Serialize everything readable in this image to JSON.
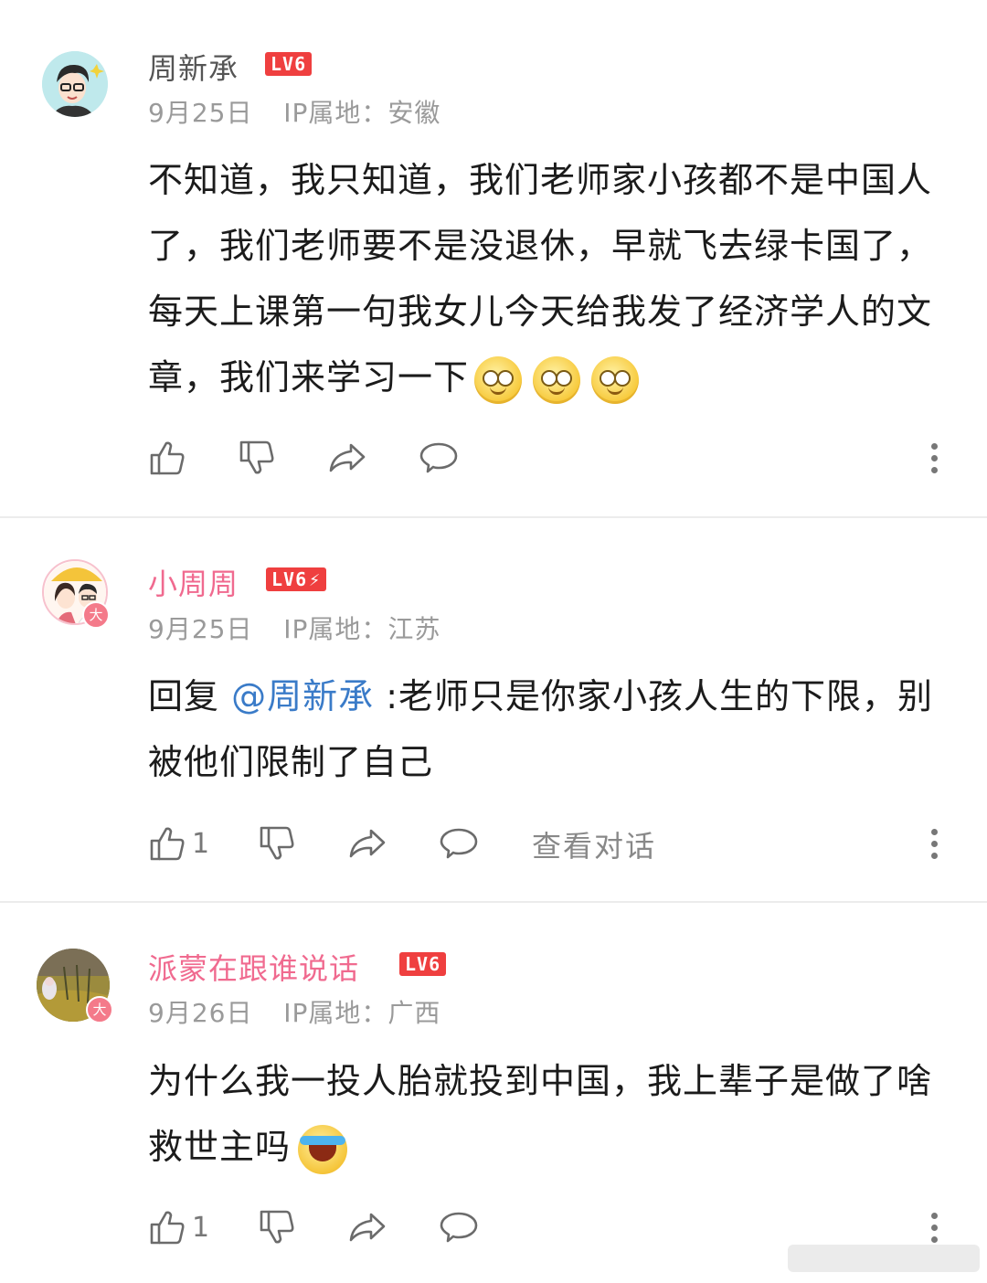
{
  "comments": [
    {
      "username": "周新承",
      "level": "LV6",
      "date": "9月25日",
      "ip_label": "IP属地：",
      "ip_location": "安徽",
      "content": "不知道，我只知道，我们老师家小孩都不是中国人了，我们老师要不是没退休，早就飞去绿卡国了，每天上课第一句我女儿今天给我发了经济学人的文章，我们来学习一下",
      "emojis": [
        "dizzy-face",
        "dizzy-face",
        "dizzy-face"
      ],
      "like_count": ""
    },
    {
      "username": "小周周",
      "level": "LV6",
      "verified_badge": "大",
      "date": "9月25日",
      "ip_label": "IP属地：",
      "ip_location": "江苏",
      "reply_prefix": "回复",
      "mention": "@周新承",
      "content": ":老师只是你家小孩人生的下限，别被他们限制了自己",
      "like_count": "1",
      "view_conversation": "查看对话"
    },
    {
      "username": "派蒙在跟谁说话",
      "level": "LV6",
      "verified_badge": "大",
      "date": "9月26日",
      "ip_label": "IP属地：",
      "ip_location": "广西",
      "content": "为什么我一投人胎就投到中国，我上辈子是做了啥救世主吗",
      "emojis": [
        "crying-laughing-face"
      ],
      "like_count": "1"
    }
  ],
  "colors": {
    "pink_username": "#f06a8f",
    "mention_blue": "#3a7bc8",
    "level_red": "#ef3f3f"
  }
}
